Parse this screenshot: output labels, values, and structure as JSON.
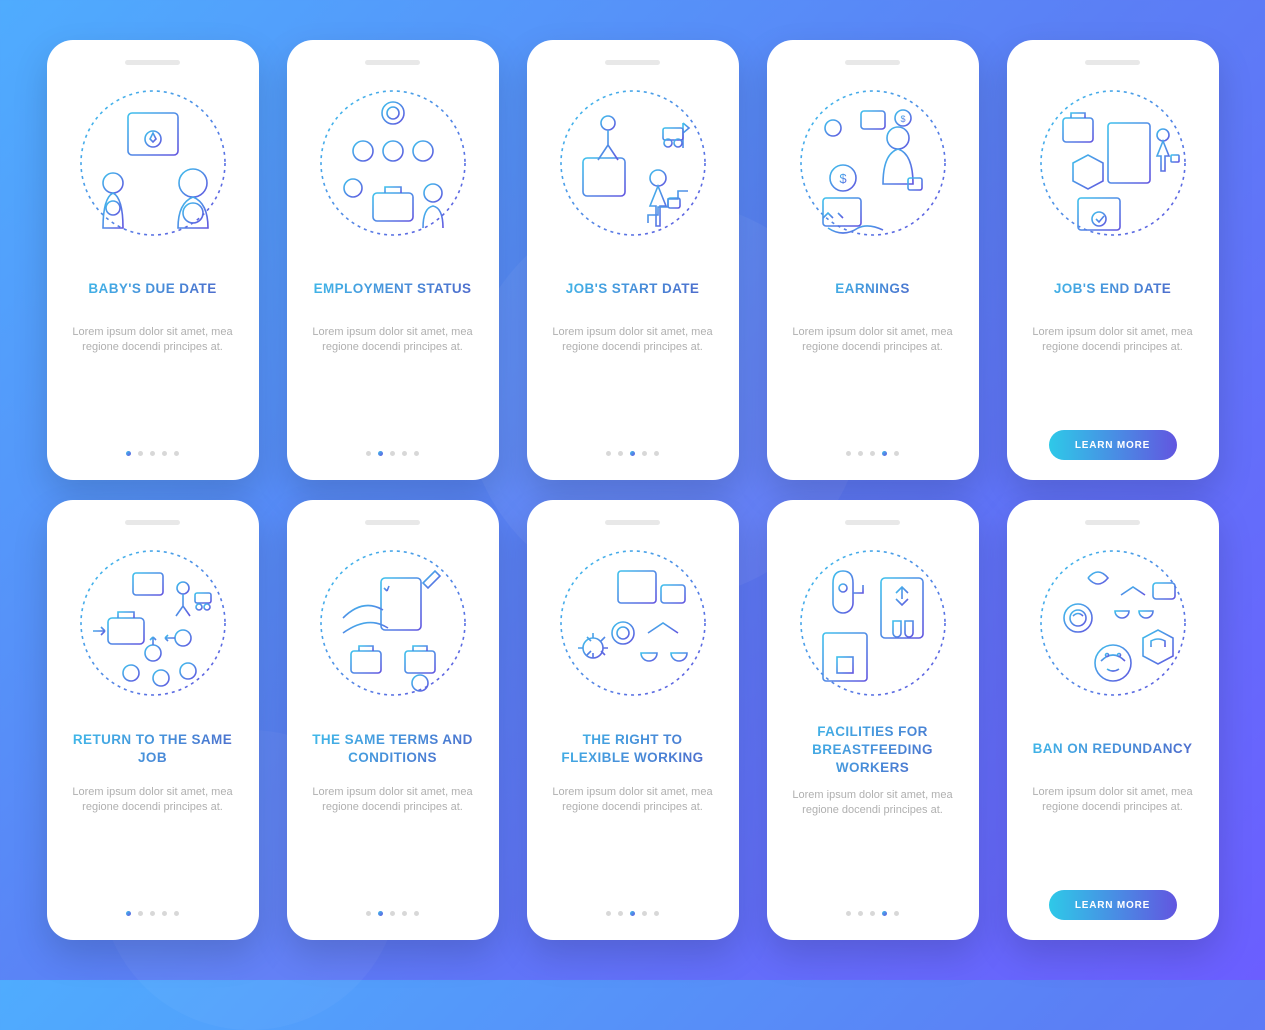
{
  "cta_label": "LEARN MORE",
  "body_text": "Lorem ipsum dolor sit amet, mea regione docendi principes at.",
  "rows": [
    {
      "screens": [
        {
          "title": "BABY'S DUE DATE",
          "active_dot": 0,
          "cta": false,
          "dots": 5,
          "icon": "baby-due"
        },
        {
          "title": "EMPLOYMENT STATUS",
          "active_dot": 1,
          "cta": false,
          "dots": 5,
          "icon": "employment"
        },
        {
          "title": "JOB'S START DATE",
          "active_dot": 2,
          "cta": false,
          "dots": 5,
          "icon": "start-date"
        },
        {
          "title": "EARNINGS",
          "active_dot": 3,
          "cta": false,
          "dots": 5,
          "icon": "earnings"
        },
        {
          "title": "JOB'S END DATE",
          "active_dot": null,
          "cta": true,
          "dots": 5,
          "icon": "end-date"
        }
      ]
    },
    {
      "screens": [
        {
          "title": "RETURN TO THE SAME JOB",
          "active_dot": 0,
          "cta": false,
          "dots": 5,
          "icon": "return-job"
        },
        {
          "title": "THE SAME TERMS AND CONDITIONS",
          "active_dot": 1,
          "cta": false,
          "dots": 5,
          "icon": "terms"
        },
        {
          "title": "THE RIGHT TO FLEXIBLE WORKING",
          "active_dot": 2,
          "cta": false,
          "dots": 5,
          "icon": "flexible"
        },
        {
          "title": "FACILITIES FOR BREASTFEEDING WORKERS",
          "active_dot": 3,
          "cta": false,
          "dots": 5,
          "icon": "facilities"
        },
        {
          "title": "BAN ON REDUNDANCY",
          "active_dot": null,
          "cta": true,
          "dots": 5,
          "icon": "ban"
        }
      ]
    }
  ]
}
